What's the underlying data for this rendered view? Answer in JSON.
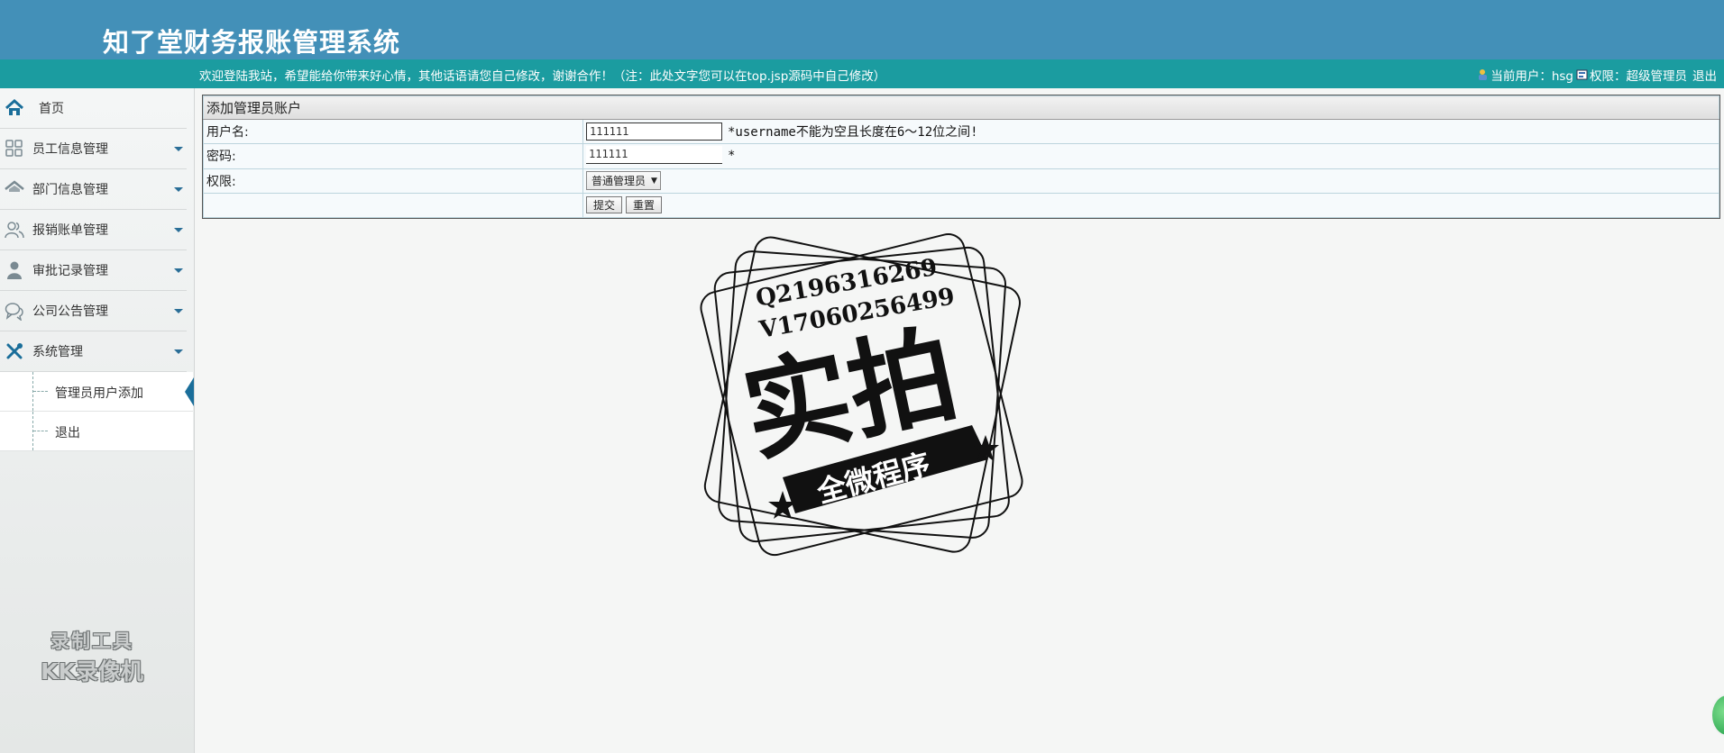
{
  "header": {
    "title": "知了堂财务报账管理系统",
    "welcome": "欢迎登陆我站，希望能给你带来好心情，其他话语请您自己修改，谢谢合作！（注：此处文字您可以在top.jsp源码中自己修改）",
    "current_user": "当前用户：hsg",
    "permission": "权限：超级管理员",
    "logout": "退出"
  },
  "sidebar": {
    "items": [
      {
        "label": "首页",
        "icon": "home-icon"
      },
      {
        "label": "员工信息管理",
        "icon": "grid-icon"
      },
      {
        "label": "部门信息管理",
        "icon": "house-icon"
      },
      {
        "label": "报销账单管理",
        "icon": "users-icon"
      },
      {
        "label": "审批记录管理",
        "icon": "person-icon"
      },
      {
        "label": "公司公告管理",
        "icon": "chat-icon"
      },
      {
        "label": "系统管理",
        "icon": "tools-icon"
      }
    ],
    "sub_items": [
      {
        "label": "管理员用户添加"
      },
      {
        "label": "退出"
      }
    ]
  },
  "form": {
    "caption": "添加管理员账户",
    "username_label": "用户名:",
    "username_value": "111111",
    "username_hint": "*username不能为空且长度在6～12位之间!",
    "password_label": "密码:",
    "password_value": "111111",
    "password_hint": "*",
    "role_label": "权限:",
    "role_selected": "普通管理员",
    "submit": "提交",
    "reset": "重置"
  },
  "watermark": {
    "stamp_line1": "Q2196316269",
    "stamp_line2": "V17060256499",
    "stamp_big": "实拍",
    "stamp_banner": "全微程序",
    "recorder_line1": "录制工具",
    "recorder_line2": "KK录像机"
  },
  "colors": {
    "header": "#4390b8",
    "topbar": "#1b9ca0",
    "accent": "#1a6e9a"
  }
}
